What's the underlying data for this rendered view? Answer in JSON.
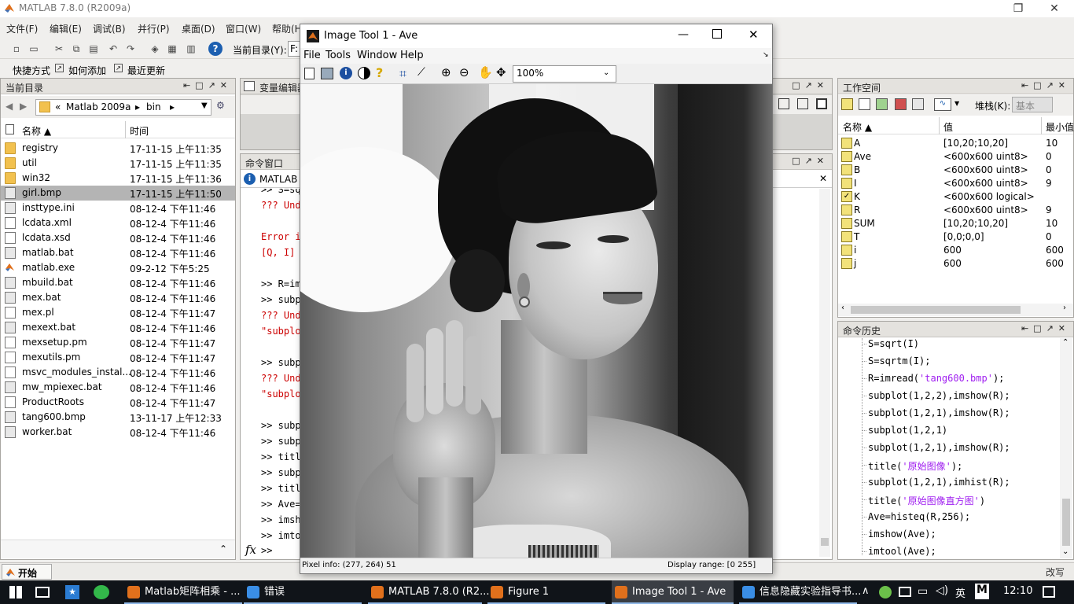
{
  "matlab": {
    "title": "MATLAB  7.8.0 (R2009a)",
    "menu": [
      "文件(F)",
      "编辑(E)",
      "调试(B)",
      "并行(P)",
      "桌面(D)",
      "窗口(W)",
      "帮助(H)"
    ],
    "current_dir_label": "当前目录(Y):",
    "current_dir_value": "F:",
    "shortcuts": [
      "快捷方式",
      "如何添加",
      "最近更新"
    ],
    "start_button": "开始(S)",
    "ovr_label": "改写"
  },
  "current_folder": {
    "title": "当前目录",
    "breadcrumb": [
      "«",
      "Matlab 2009a",
      "▸",
      "bin",
      "▸"
    ],
    "col_name": "名称 ▲",
    "col_time": "时间",
    "files": [
      {
        "name": "registry",
        "time": "17-11-15 上午11:35",
        "kind": "folder"
      },
      {
        "name": "util",
        "time": "17-11-15 上午11:35",
        "kind": "folder"
      },
      {
        "name": "win32",
        "time": "17-11-15 上午11:36",
        "kind": "folder"
      },
      {
        "name": "girl.bmp",
        "time": "17-11-15 上午11:50",
        "kind": "bat",
        "selected": true
      },
      {
        "name": "insttype.ini",
        "time": "08-12-4 下午11:46",
        "kind": "bat"
      },
      {
        "name": "lcdata.xml",
        "time": "08-12-4 下午11:46",
        "kind": "file"
      },
      {
        "name": "lcdata.xsd",
        "time": "08-12-4 下午11:46",
        "kind": "file"
      },
      {
        "name": "matlab.bat",
        "time": "08-12-4 下午11:46",
        "kind": "bat"
      },
      {
        "name": "matlab.exe",
        "time": "09-2-12 下午5:25",
        "kind": "exe"
      },
      {
        "name": "mbuild.bat",
        "time": "08-12-4 下午11:46",
        "kind": "bat"
      },
      {
        "name": "mex.bat",
        "time": "08-12-4 下午11:46",
        "kind": "bat"
      },
      {
        "name": "mex.pl",
        "time": "08-12-4 下午11:47",
        "kind": "file"
      },
      {
        "name": "mexext.bat",
        "time": "08-12-4 下午11:46",
        "kind": "bat"
      },
      {
        "name": "mexsetup.pm",
        "time": "08-12-4 下午11:47",
        "kind": "file"
      },
      {
        "name": "mexutils.pm",
        "time": "08-12-4 下午11:47",
        "kind": "file"
      },
      {
        "name": "msvc_modules_instal...",
        "time": "08-12-4 下午11:46",
        "kind": "file"
      },
      {
        "name": "mw_mpiexec.bat",
        "time": "08-12-4 下午11:46",
        "kind": "bat"
      },
      {
        "name": "ProductRoots",
        "time": "08-12-4 下午11:47",
        "kind": "file"
      },
      {
        "name": "tang600.bmp",
        "time": "13-11-17 上午12:33",
        "kind": "bat"
      },
      {
        "name": "worker.bat",
        "time": "08-12-4 下午11:46",
        "kind": "bat"
      }
    ]
  },
  "variable_editor": {
    "title": "变量编辑器"
  },
  "command_window": {
    "title": "命令窗口",
    "notice": "MATLAB",
    "lines": [
      {
        "text": ">> S=sq",
        "color": "blk"
      },
      {
        "text": "??? Und",
        "color": "red"
      },
      {
        "text": "",
        "color": "blk"
      },
      {
        "text": "Error i",
        "color": "red"
      },
      {
        "text": "[Q, I]",
        "color": "red"
      },
      {
        "text": "",
        "color": "blk"
      },
      {
        "text": ">> R=im",
        "color": "blk"
      },
      {
        "text": ">> subp",
        "color": "blk"
      },
      {
        "text": "??? Und",
        "color": "red"
      },
      {
        "text": "\"subplo",
        "color": "red"
      },
      {
        "text": "",
        "color": "blk"
      },
      {
        "text": ">> subp",
        "color": "blk"
      },
      {
        "text": "??? Und",
        "color": "red"
      },
      {
        "text": "\"subplo",
        "color": "red"
      },
      {
        "text": "",
        "color": "blk"
      },
      {
        "text": ">> subp",
        "color": "blk"
      },
      {
        "text": ">> subp",
        "color": "blk"
      },
      {
        "text": ">> titl",
        "color": "blk"
      },
      {
        "text": ">> subp",
        "color": "blk"
      },
      {
        "text": ">> titl",
        "color": "blk"
      },
      {
        "text": ">> Ave=",
        "color": "blk"
      },
      {
        "text": ">> imsh",
        "color": "blk"
      },
      {
        "text": ">> imto",
        "color": "blk"
      }
    ],
    "prompt": ">>",
    "fx": "fx"
  },
  "workspace": {
    "title": "工作空间",
    "stack_label": "堆栈(K):",
    "stack_value": "基本",
    "col_name": "名称 ▲",
    "col_value": "值",
    "col_min": "最小值",
    "vars": [
      {
        "name": "A",
        "value": "[10,20;10,20]",
        "min": "10",
        "kind": "num"
      },
      {
        "name": "Ave",
        "value": "<600x600 uint8>",
        "min": "0",
        "kind": "num"
      },
      {
        "name": "B",
        "value": "<600x600 uint8>",
        "min": "0",
        "kind": "num"
      },
      {
        "name": "I",
        "value": "<600x600 uint8>",
        "min": "9",
        "kind": "num"
      },
      {
        "name": "K",
        "value": "<600x600 logical>",
        "min": "",
        "kind": "logical"
      },
      {
        "name": "R",
        "value": "<600x600 uint8>",
        "min": "9",
        "kind": "num"
      },
      {
        "name": "SUM",
        "value": "[10,20;10,20]",
        "min": "10",
        "kind": "num"
      },
      {
        "name": "T",
        "value": "[0,0;0,0]",
        "min": "0",
        "kind": "num"
      },
      {
        "name": "i",
        "value": "600",
        "min": "600",
        "kind": "num"
      },
      {
        "name": "j",
        "value": "600",
        "min": "600",
        "kind": "num"
      }
    ]
  },
  "history": {
    "title": "命令历史",
    "lines": [
      {
        "pre": "S=sqrt(I)",
        "str": "",
        "post": ""
      },
      {
        "pre": "S=sqrtm(I);",
        "str": "",
        "post": ""
      },
      {
        "pre": "R=imread(",
        "str": "'tang600.bmp'",
        "post": ");"
      },
      {
        "pre": "subplot(1,2,2),imshow(R);",
        "str": "",
        "post": ""
      },
      {
        "pre": "subplot(1,2,1),imshow(R);",
        "str": "",
        "post": ""
      },
      {
        "pre": "subplot(1,2,1)",
        "str": "",
        "post": ""
      },
      {
        "pre": "subplot(1,2,1),imshow(R);",
        "str": "",
        "post": ""
      },
      {
        "pre": "title(",
        "str": "'原始图像'",
        "post": ");"
      },
      {
        "pre": "subplot(1,2,1),imhist(R);",
        "str": "",
        "post": ""
      },
      {
        "pre": "title(",
        "str": "'原始图像直方图'",
        "post": ")"
      },
      {
        "pre": "Ave=histeq(R,256);",
        "str": "",
        "post": ""
      },
      {
        "pre": "imshow(Ave);",
        "str": "",
        "post": ""
      },
      {
        "pre": "imtool(Ave);",
        "str": "",
        "post": ""
      }
    ]
  },
  "imtool": {
    "title": "Image Tool 1 - Ave",
    "menu": [
      "File",
      "Tools",
      "Window",
      "Help"
    ],
    "zoom": "100%",
    "pixel_info": "Pixel info: (277, 264)  51",
    "display_range": "Display range: [0 255]"
  },
  "taskbar": {
    "tasks": [
      {
        "label": "Matlab矩阵相乘 - ...",
        "active": false
      },
      {
        "label": "错误",
        "active": false
      },
      {
        "label": "MATLAB  7.8.0 (R2...",
        "active": false
      },
      {
        "label": "Figure 1",
        "active": false
      },
      {
        "label": "Image Tool 1 - Ave",
        "active": true
      },
      {
        "label": "信息隐藏实验指导书...",
        "active": false
      }
    ],
    "ime": "英",
    "ime2": "M",
    "clock": "12:10"
  }
}
